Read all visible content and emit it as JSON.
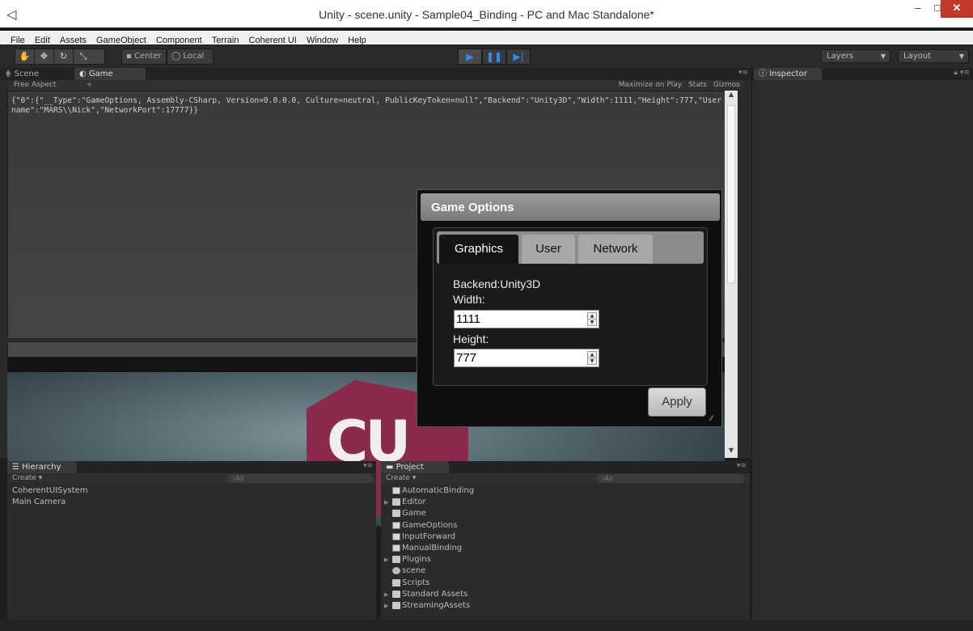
{
  "window": {
    "title": "Unity - scene.unity - Sample04_Binding - PC and Mac Standalone*",
    "controls": [
      "‒",
      "□",
      "✕"
    ]
  },
  "menu": [
    "File",
    "Edit",
    "Assets",
    "GameObject",
    "Component",
    "Terrain",
    "Coherent UI",
    "Window",
    "Help"
  ],
  "toolbar": {
    "pivot_center": "Center",
    "pivot_local": "Local",
    "layers": "Layers",
    "layout": "Layout"
  },
  "game_panel": {
    "tabs": [
      "Scene",
      "Game"
    ],
    "active_tab": "Game",
    "aspect": "Free Aspect",
    "options": [
      "Maximize on Play",
      "Stats",
      "Gizmos"
    ],
    "json_text": "{\"0\":{\"__Type\":\"GameOptions, Assembly-CSharp, Version=0.0.0.0, Culture=neutral, PublicKeyToken=null\",\"Backend\":\"Unity3D\",\"Width\":1111,\"Height\":777,\"Username\":\"MARS\\\\Nick\",\"NetworkPort\":17777}}"
  },
  "game_options": {
    "title": "Game Options",
    "tabs": [
      "Graphics",
      "User",
      "Network"
    ],
    "active_tab": "Graphics",
    "backend_label": "Backend:Unity3D",
    "width_label": "Width:",
    "width_value": "1111",
    "height_label": "Height:",
    "height_value": "777",
    "apply_label": "Apply"
  },
  "inspector": {
    "tab": "Inspector"
  },
  "hierarchy": {
    "tab": "Hierarchy",
    "create": "Create",
    "search": "All",
    "items": [
      "CoherentUISystem",
      "Main Camera"
    ]
  },
  "project": {
    "tab": "Project",
    "create": "Create",
    "search": "All",
    "items": [
      {
        "label": "AutomaticBinding",
        "icon": "script-icon",
        "foldable": false
      },
      {
        "label": "Editor",
        "icon": "folder-icon",
        "foldable": true
      },
      {
        "label": "Game",
        "icon": "folder-icon",
        "foldable": false
      },
      {
        "label": "GameOptions",
        "icon": "script-icon",
        "foldable": false
      },
      {
        "label": "InputForward",
        "icon": "script-icon",
        "foldable": false
      },
      {
        "label": "ManualBinding",
        "icon": "script-icon",
        "foldable": false
      },
      {
        "label": "Plugins",
        "icon": "folder-icon",
        "foldable": true
      },
      {
        "label": "scene",
        "icon": "unity-scene-icon",
        "foldable": false
      },
      {
        "label": "Scripts",
        "icon": "folder-icon",
        "foldable": false
      },
      {
        "label": "Standard Assets",
        "icon": "folder-icon",
        "foldable": true
      },
      {
        "label": "StreamingAssets",
        "icon": "folder-icon",
        "foldable": true
      }
    ]
  },
  "colors": {
    "unity_dark_bg": "#2b2b2b",
    "play_blue": "#2e8bf0",
    "logo_magenta": "#8a2b4d",
    "close_red": "#c0392b"
  }
}
